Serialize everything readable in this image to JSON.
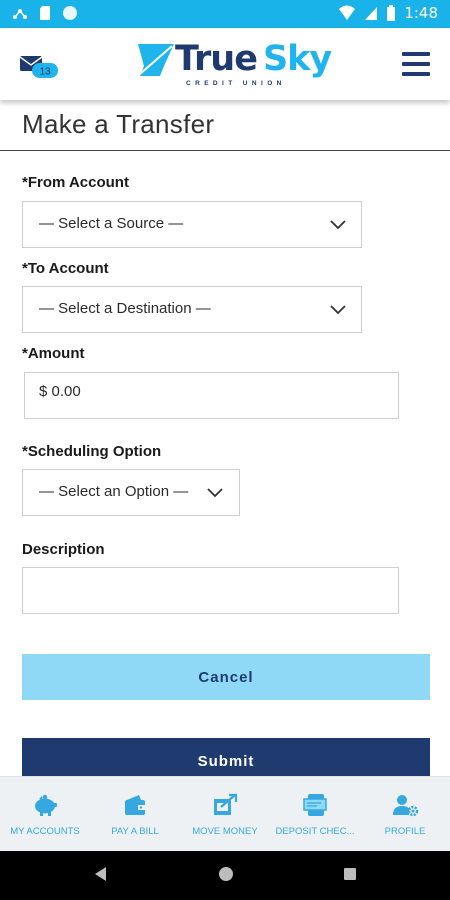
{
  "status_bar": {
    "time": "1:48"
  },
  "header": {
    "mail_badge": "13",
    "logo_primary": "True",
    "logo_secondary": "Sky",
    "logo_tagline": "CREDIT UNION"
  },
  "page": {
    "title": "Make a Transfer"
  },
  "form": {
    "from_account": {
      "label": "*From Account",
      "value": "— Select a Source —"
    },
    "to_account": {
      "label": "*To Account",
      "value": "— Select a Destination —"
    },
    "amount": {
      "label": "*Amount",
      "value": "$ 0.00"
    },
    "scheduling": {
      "label": "*Scheduling Option",
      "value": "— Select an Option —"
    },
    "description": {
      "label": "Description",
      "value": ""
    }
  },
  "buttons": {
    "cancel": "Cancel",
    "submit": "Submit"
  },
  "tabs": [
    {
      "label": "MY ACCOUNTS",
      "icon": "piggy-bank-icon"
    },
    {
      "label": "PAY A BILL",
      "icon": "wallet-icon"
    },
    {
      "label": "MOVE MONEY",
      "icon": "transfer-icon"
    },
    {
      "label": "DEPOSIT CHEC...",
      "icon": "deposit-check-icon"
    },
    {
      "label": "PROFILE",
      "icon": "user-gear-icon"
    }
  ],
  "colors": {
    "status_bar": "#19b3ea",
    "brand_navy": "#1e3a6e",
    "brand_sky": "#1fb5ec",
    "cancel_bg": "#8fd9f7",
    "tab_label": "#35a9df"
  }
}
